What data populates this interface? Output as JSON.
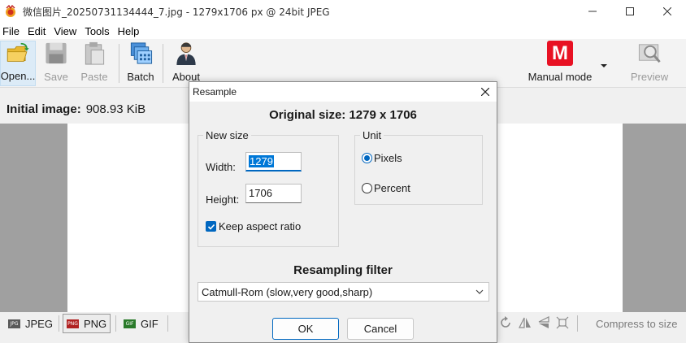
{
  "window": {
    "title": "微信图片_20250731134444_7.jpg - 1279x1706 px @ 24bit JPEG",
    "minimize_icon": "minimize-icon",
    "maximize_icon": "maximize-icon",
    "close_icon": "close-icon"
  },
  "menu": {
    "items": [
      "File",
      "Edit",
      "View",
      "Tools",
      "Help"
    ]
  },
  "toolbar": {
    "open": "Open...",
    "save": "Save",
    "paste": "Paste",
    "batch": "Batch",
    "about": "About",
    "mode_badge": "M",
    "mode": "Manual mode",
    "preview": "Preview",
    "accent": "#e81123"
  },
  "info": {
    "label": "Initial image:",
    "value": "908.93 KiB"
  },
  "formats": {
    "jpeg": "JPEG",
    "png": "PNG",
    "gif": "GIF",
    "jpeg_icon_text": "JPG",
    "png_icon_text": "PNG",
    "gif_icon_text": "GIF"
  },
  "status": {
    "compress": "Compress to size"
  },
  "dialog": {
    "title": "Resample",
    "original_size": "Original size: 1279 x 1706",
    "new_size_group": "New size",
    "width_label": "Width:",
    "width_value": "1279",
    "height_label": "Height:",
    "height_value": "1706",
    "keep_aspect": "Keep aspect ratio",
    "unit_group": "Unit",
    "unit_pixels": "Pixels",
    "unit_percent": "Percent",
    "filter_title": "Resampling filter",
    "filter_value": "Catmull-Rom (slow,very good,sharp)",
    "ok": "OK",
    "cancel": "Cancel",
    "accent": "#0067c0"
  }
}
